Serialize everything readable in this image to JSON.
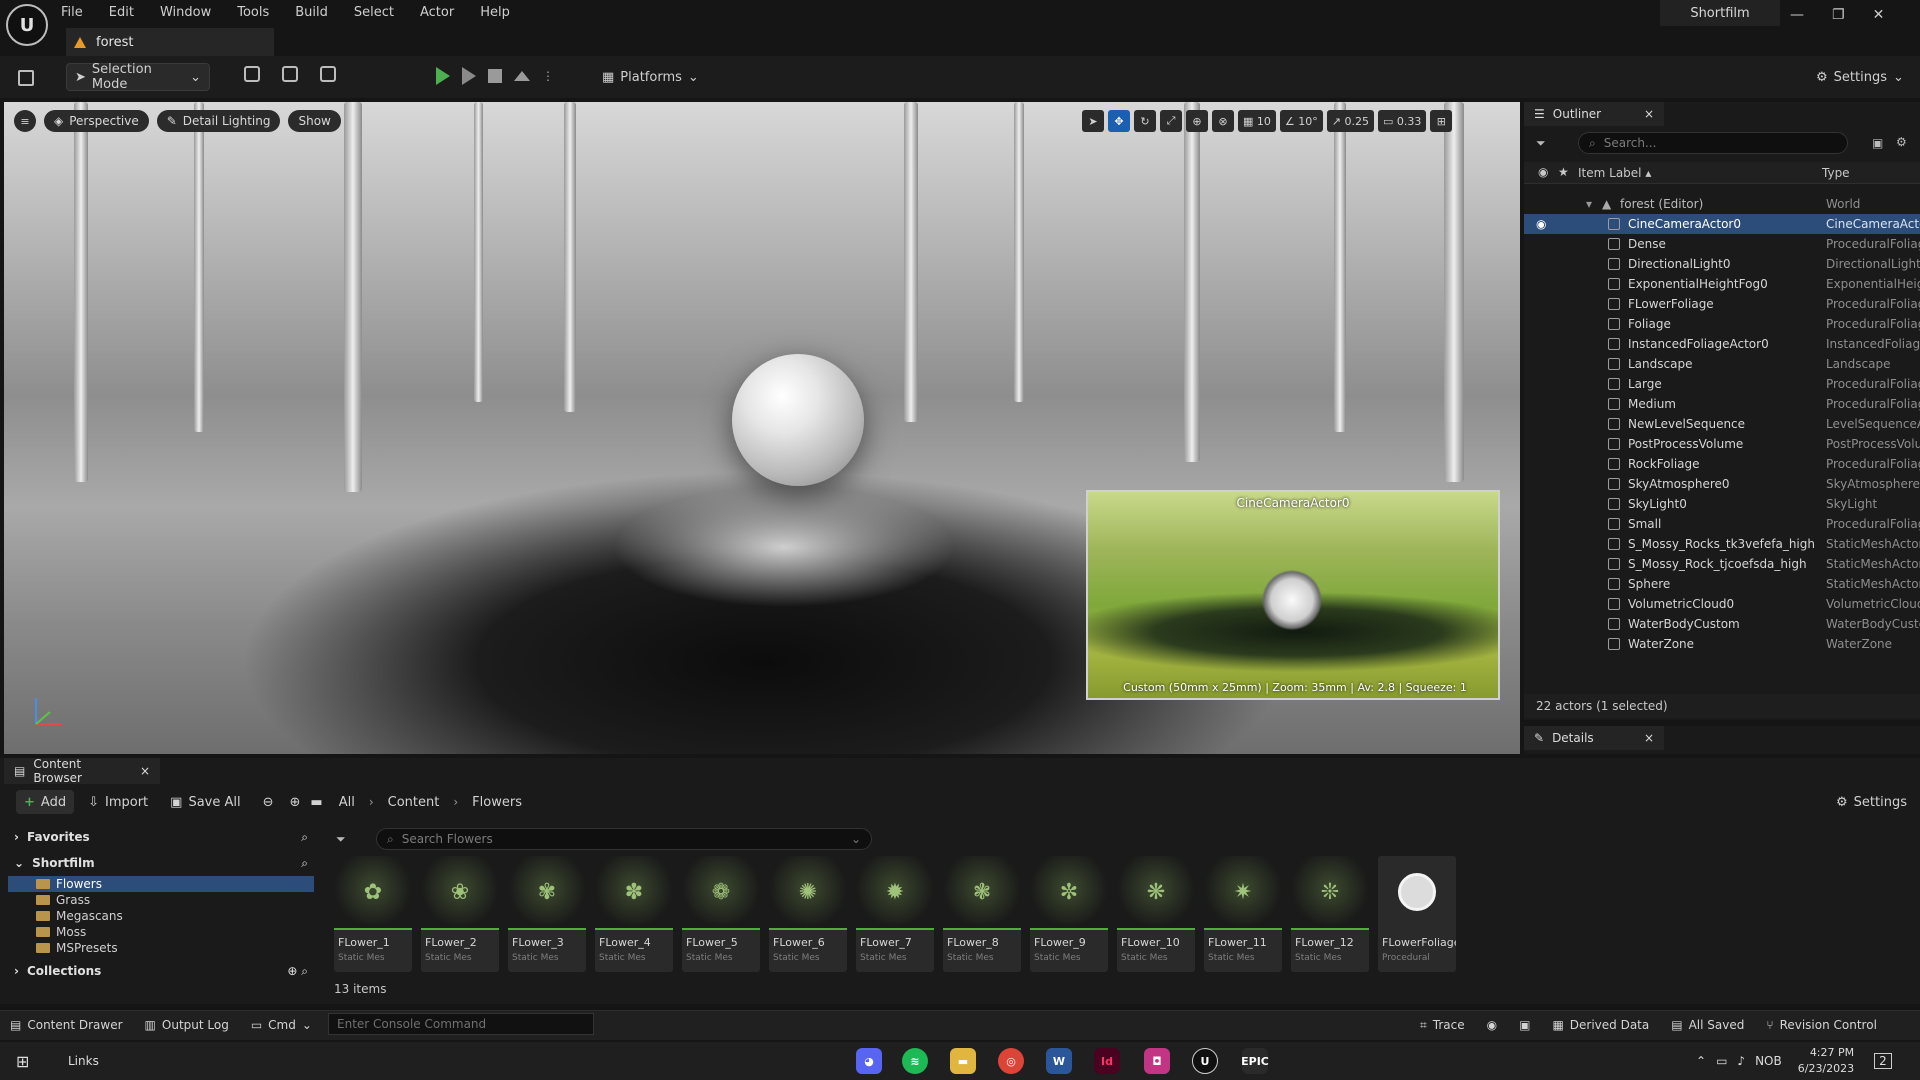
{
  "menu": [
    "File",
    "Edit",
    "Window",
    "Tools",
    "Build",
    "Select",
    "Actor",
    "Help"
  ],
  "project_name": "Shortfilm",
  "level_tab": "forest",
  "toolbar": {
    "selection_mode": "Selection Mode",
    "platforms": "Platforms",
    "settings": "Settings"
  },
  "viewport": {
    "perspective": "Perspective",
    "lighting": "Detail Lighting",
    "show": "Show",
    "grid_snap": "10",
    "rotation_snap": "10°",
    "scale_snap": "0.25",
    "camera_speed": "0.33",
    "camera_preview_title": "CineCameraActor0",
    "camera_preview_info": "Custom (50mm x 25mm) | Zoom: 35mm | Av: 2.8 | Squeeze: 1"
  },
  "outliner": {
    "title": "Outliner",
    "search_placeholder": "Search...",
    "col_label": "Item Label",
    "col_type": "Type",
    "root": {
      "name": "forest (Editor)",
      "type": "World"
    },
    "rows": [
      {
        "name": "CineCameraActor0",
        "type": "CineCameraActor"
      },
      {
        "name": "Dense",
        "type": "ProceduralFoliage"
      },
      {
        "name": "DirectionalLight0",
        "type": "DirectionalLight"
      },
      {
        "name": "ExponentialHeightFog0",
        "type": "ExponentialHeightFog"
      },
      {
        "name": "FLowerFoliage",
        "type": "ProceduralFoliage"
      },
      {
        "name": "Foliage",
        "type": "ProceduralFoliage"
      },
      {
        "name": "InstancedFoliageActor0",
        "type": "InstancedFoliageActor"
      },
      {
        "name": "Landscape",
        "type": "Landscape"
      },
      {
        "name": "Large",
        "type": "ProceduralFoliage"
      },
      {
        "name": "Medium",
        "type": "ProceduralFoliage"
      },
      {
        "name": "NewLevelSequence",
        "type": "LevelSequenceActor"
      },
      {
        "name": "PostProcessVolume",
        "type": "PostProcessVolume"
      },
      {
        "name": "RockFoliage",
        "type": "ProceduralFoliage"
      },
      {
        "name": "SkyAtmosphere0",
        "type": "SkyAtmosphere"
      },
      {
        "name": "SkyLight0",
        "type": "SkyLight"
      },
      {
        "name": "Small",
        "type": "ProceduralFoliage"
      },
      {
        "name": "S_Mossy_Rocks_tk3vefefa_high",
        "type": "StaticMeshActor"
      },
      {
        "name": "S_Mossy_Rock_tjcoefsda_high",
        "type": "StaticMeshActor"
      },
      {
        "name": "Sphere",
        "type": "StaticMeshActor"
      },
      {
        "name": "VolumetricCloud0",
        "type": "VolumetricCloud"
      },
      {
        "name": "WaterBodyCustom",
        "type": "WaterBodyCustom"
      },
      {
        "name": "WaterZone",
        "type": "WaterZone"
      }
    ],
    "count": "22 actors (1 selected)"
  },
  "details": {
    "title": "Details"
  },
  "content_browser": {
    "title": "Content Browser",
    "add": "Add",
    "import": "Import",
    "save_all": "Save All",
    "breadcrumb": [
      "All",
      "Content",
      "Flowers"
    ],
    "settings": "Settings",
    "favorites": "Favorites",
    "project_root": "Shortfilm",
    "folders": [
      "Flowers",
      "Grass",
      "Megascans",
      "Moss",
      "MSPresets"
    ],
    "collections": "Collections",
    "search_placeholder": "Search Flowers",
    "assets": [
      {
        "name": "FLower_1",
        "type": "Static Mes"
      },
      {
        "name": "FLower_2",
        "type": "Static Mes"
      },
      {
        "name": "FLower_3",
        "type": "Static Mes"
      },
      {
        "name": "FLower_4",
        "type": "Static Mes"
      },
      {
        "name": "FLower_5",
        "type": "Static Mes"
      },
      {
        "name": "FLower_6",
        "type": "Static Mes"
      },
      {
        "name": "FLower_7",
        "type": "Static Mes"
      },
      {
        "name": "FLower_8",
        "type": "Static Mes"
      },
      {
        "name": "FLower_9",
        "type": "Static Mes"
      },
      {
        "name": "FLower_10",
        "type": "Static Mes"
      },
      {
        "name": "FLower_11",
        "type": "Static Mes"
      },
      {
        "name": "FLower_12",
        "type": "Static Mes"
      },
      {
        "name": "FLowerFoliage",
        "type": "Procedural"
      }
    ],
    "item_count": "13 items"
  },
  "statusbar": {
    "content_drawer": "Content Drawer",
    "output_log": "Output Log",
    "cmd": "Cmd",
    "console_placeholder": "Enter Console Command",
    "trace": "Trace",
    "derived_data": "Derived Data",
    "all_saved": "All Saved",
    "revision_control": "Revision Control"
  },
  "taskbar": {
    "links": "Links",
    "language": "NOB",
    "time": "4:27 PM",
    "date": "6/23/2023",
    "notifications": "2"
  }
}
